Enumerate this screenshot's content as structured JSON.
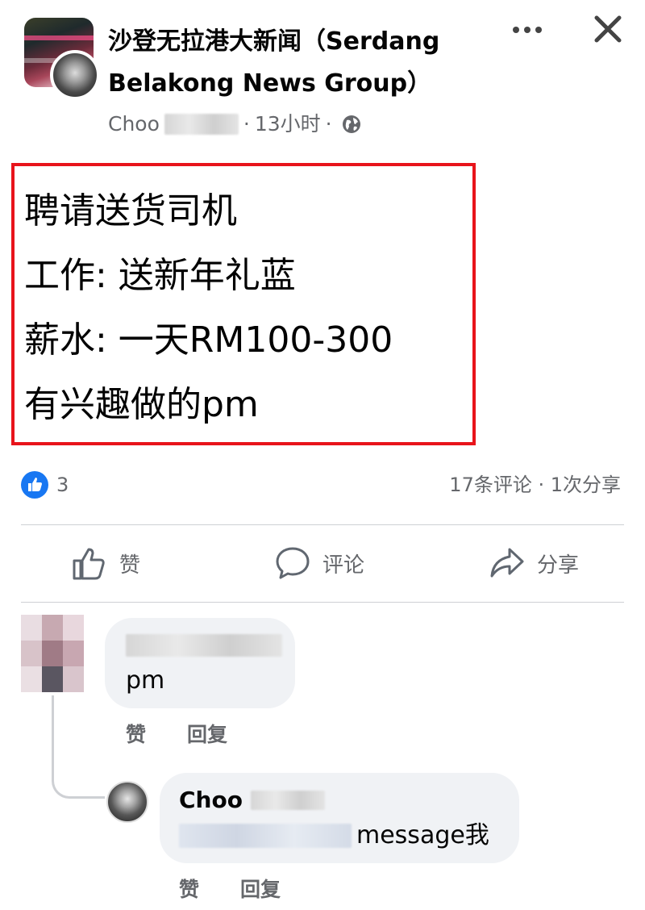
{
  "post": {
    "group_name": "沙登无拉港大新闻（Serdang Belakong News Group）",
    "author_visible": "Choo",
    "time": "13小时",
    "separator": "·",
    "privacy_icon": "globe-icon",
    "body_lines": [
      "聘请送货司机",
      "工作: 送新年礼蓝",
      "薪水: 一天RM100-300",
      "有兴趣做的pm"
    ],
    "highlight_color": "#e8141b"
  },
  "reactions": {
    "like_count": "3",
    "stats": "17条评论 · 1次分享",
    "icon": "like-badge-icon",
    "accent": "#1877f2"
  },
  "actions": {
    "like": "赞",
    "comment": "评论",
    "share": "分享"
  },
  "comments": [
    {
      "text": "pm",
      "like_label": "赞",
      "reply_label": "回复"
    },
    {
      "author_visible": "Choo",
      "text": "message我",
      "like_label": "赞",
      "reply_label": "回复"
    }
  ],
  "colors": {
    "secondary_text": "#65676b",
    "bubble": "#f0f2f5",
    "divider": "#ced0d4"
  }
}
